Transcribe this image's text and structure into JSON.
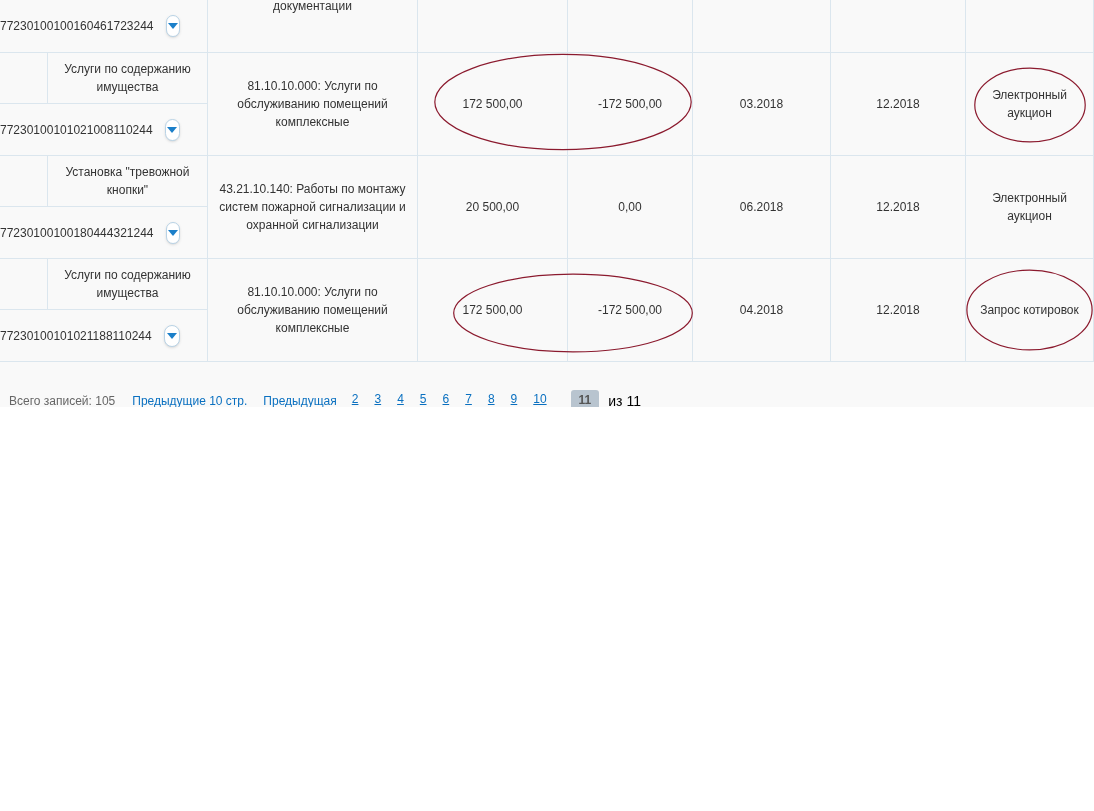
{
  "table": {
    "partial_row": {
      "code": "77230100100160461723244",
      "description": "документации"
    },
    "rows": [
      {
        "name": "Услуги по содержанию имущества",
        "code": "77230100101021008110244",
        "description": "81.10.10.000: Услуги по обслуживанию помещений комплексные",
        "amount": "172 500,00",
        "change": "-172 500,00",
        "start": "03.2018",
        "end": "12.2018",
        "method": "Электронный аукцион",
        "amounts_circled": true,
        "method_circled": true
      },
      {
        "name": "Установка \"тревожной кнопки\"",
        "code": "77230100100180444321244",
        "description": "43.21.10.140: Работы по монтажу систем пожарной сигнализации и охранной сигнализации",
        "amount": "20 500,00",
        "change": "0,00",
        "start": "06.2018",
        "end": "12.2018",
        "method": "Электронный аукцион",
        "amounts_circled": false,
        "method_circled": false
      },
      {
        "name": "Услуги по содержанию имущества",
        "code": "77230100101021188110244",
        "description": "81.10.10.000: Услуги по обслуживанию помещений комплексные",
        "amount": "172 500,00",
        "change": "-172 500,00",
        "start": "04.2018",
        "end": "12.2018",
        "method": "Запрос котировок",
        "amounts_circled": true,
        "method_circled": true
      }
    ]
  },
  "pager": {
    "total": "Всего записей: 105",
    "prev_ten": "Предыдущие 10 стр.",
    "prev": "Предыдущая",
    "pages": [
      {
        "label": "2",
        "selected": false
      },
      {
        "label": "3",
        "selected": false
      },
      {
        "label": "4",
        "selected": false
      },
      {
        "label": "5",
        "selected": false
      },
      {
        "label": "6",
        "selected": false
      },
      {
        "label": "7",
        "selected": false
      },
      {
        "label": "8",
        "selected": false
      },
      {
        "label": "9",
        "selected": false
      },
      {
        "label": "10",
        "selected": false
      },
      {
        "label": "11",
        "selected": true
      }
    ],
    "of": "из 11"
  }
}
